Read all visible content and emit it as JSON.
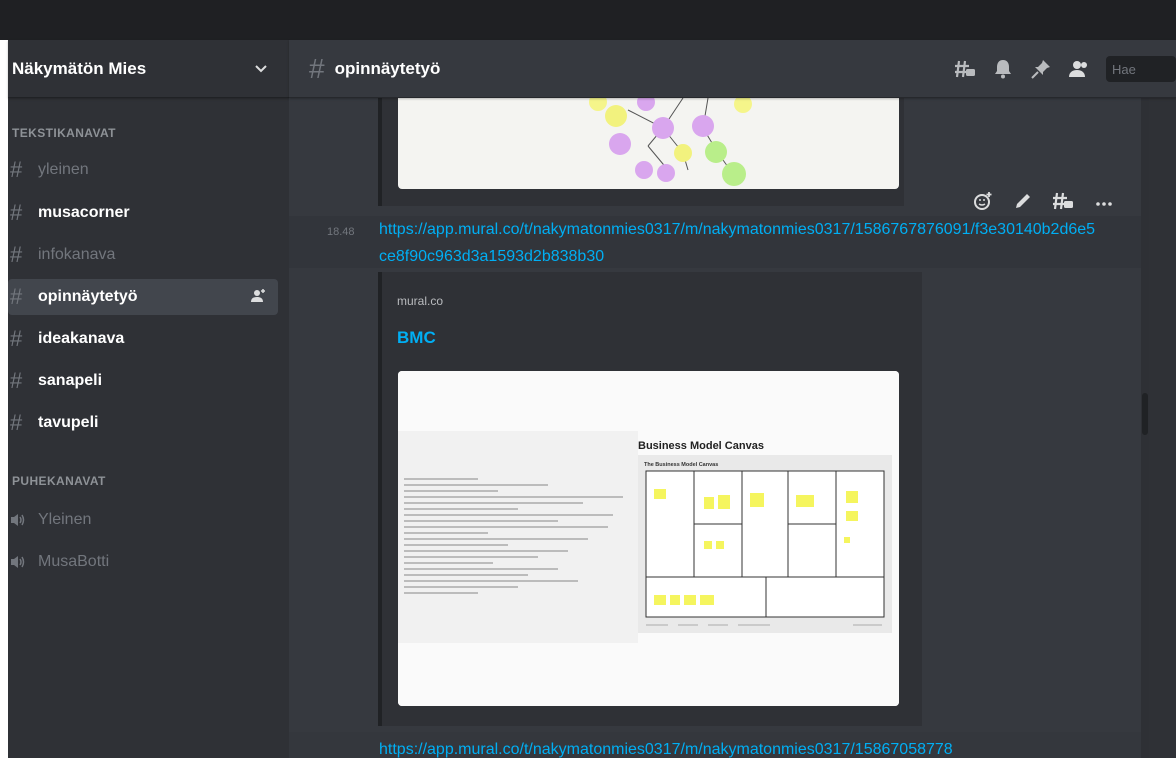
{
  "guild": {
    "name": "Näkymätön Mies"
  },
  "sidebar": {
    "text_category": "TEKSTIKANAVAT",
    "voice_category": "PUHEKANAVAT",
    "text_channels": [
      {
        "label": "yleinen",
        "state": "muted"
      },
      {
        "label": "musacorner",
        "state": "unread"
      },
      {
        "label": "infokanava",
        "state": "muted"
      },
      {
        "label": "opinnäytetyö",
        "state": "active"
      },
      {
        "label": "ideakanava",
        "state": "unread"
      },
      {
        "label": "sanapeli",
        "state": "unread"
      },
      {
        "label": "tavupeli",
        "state": "unread"
      }
    ],
    "voice_channels": [
      {
        "label": "Yleinen"
      },
      {
        "label": "MusaBotti"
      }
    ]
  },
  "header": {
    "channel": "opinnäytetyö",
    "search_placeholder": "Hae"
  },
  "messages": [
    {
      "time": "18.48",
      "link": "https://app.mural.co/t/nakymatonmies0317/m/nakymatonmies0317/1586767876091/f3e30140b2d6e5ce8f90c963d3a1593d2b838b30",
      "embed": {
        "provider": "mural.co",
        "title": "BMC",
        "image": {
          "heading": "Business Model Canvas",
          "subheading": "The Business Model Canvas"
        }
      }
    },
    {
      "link": "https://app.mural.co/t/nakymatonmies0317/m/nakymatonmies0317/15867058778"
    }
  ],
  "colors": {
    "sidebar": "#2f3136",
    "main": "#36393f",
    "link": "#00aff4",
    "titlebar": "#1f2023"
  }
}
